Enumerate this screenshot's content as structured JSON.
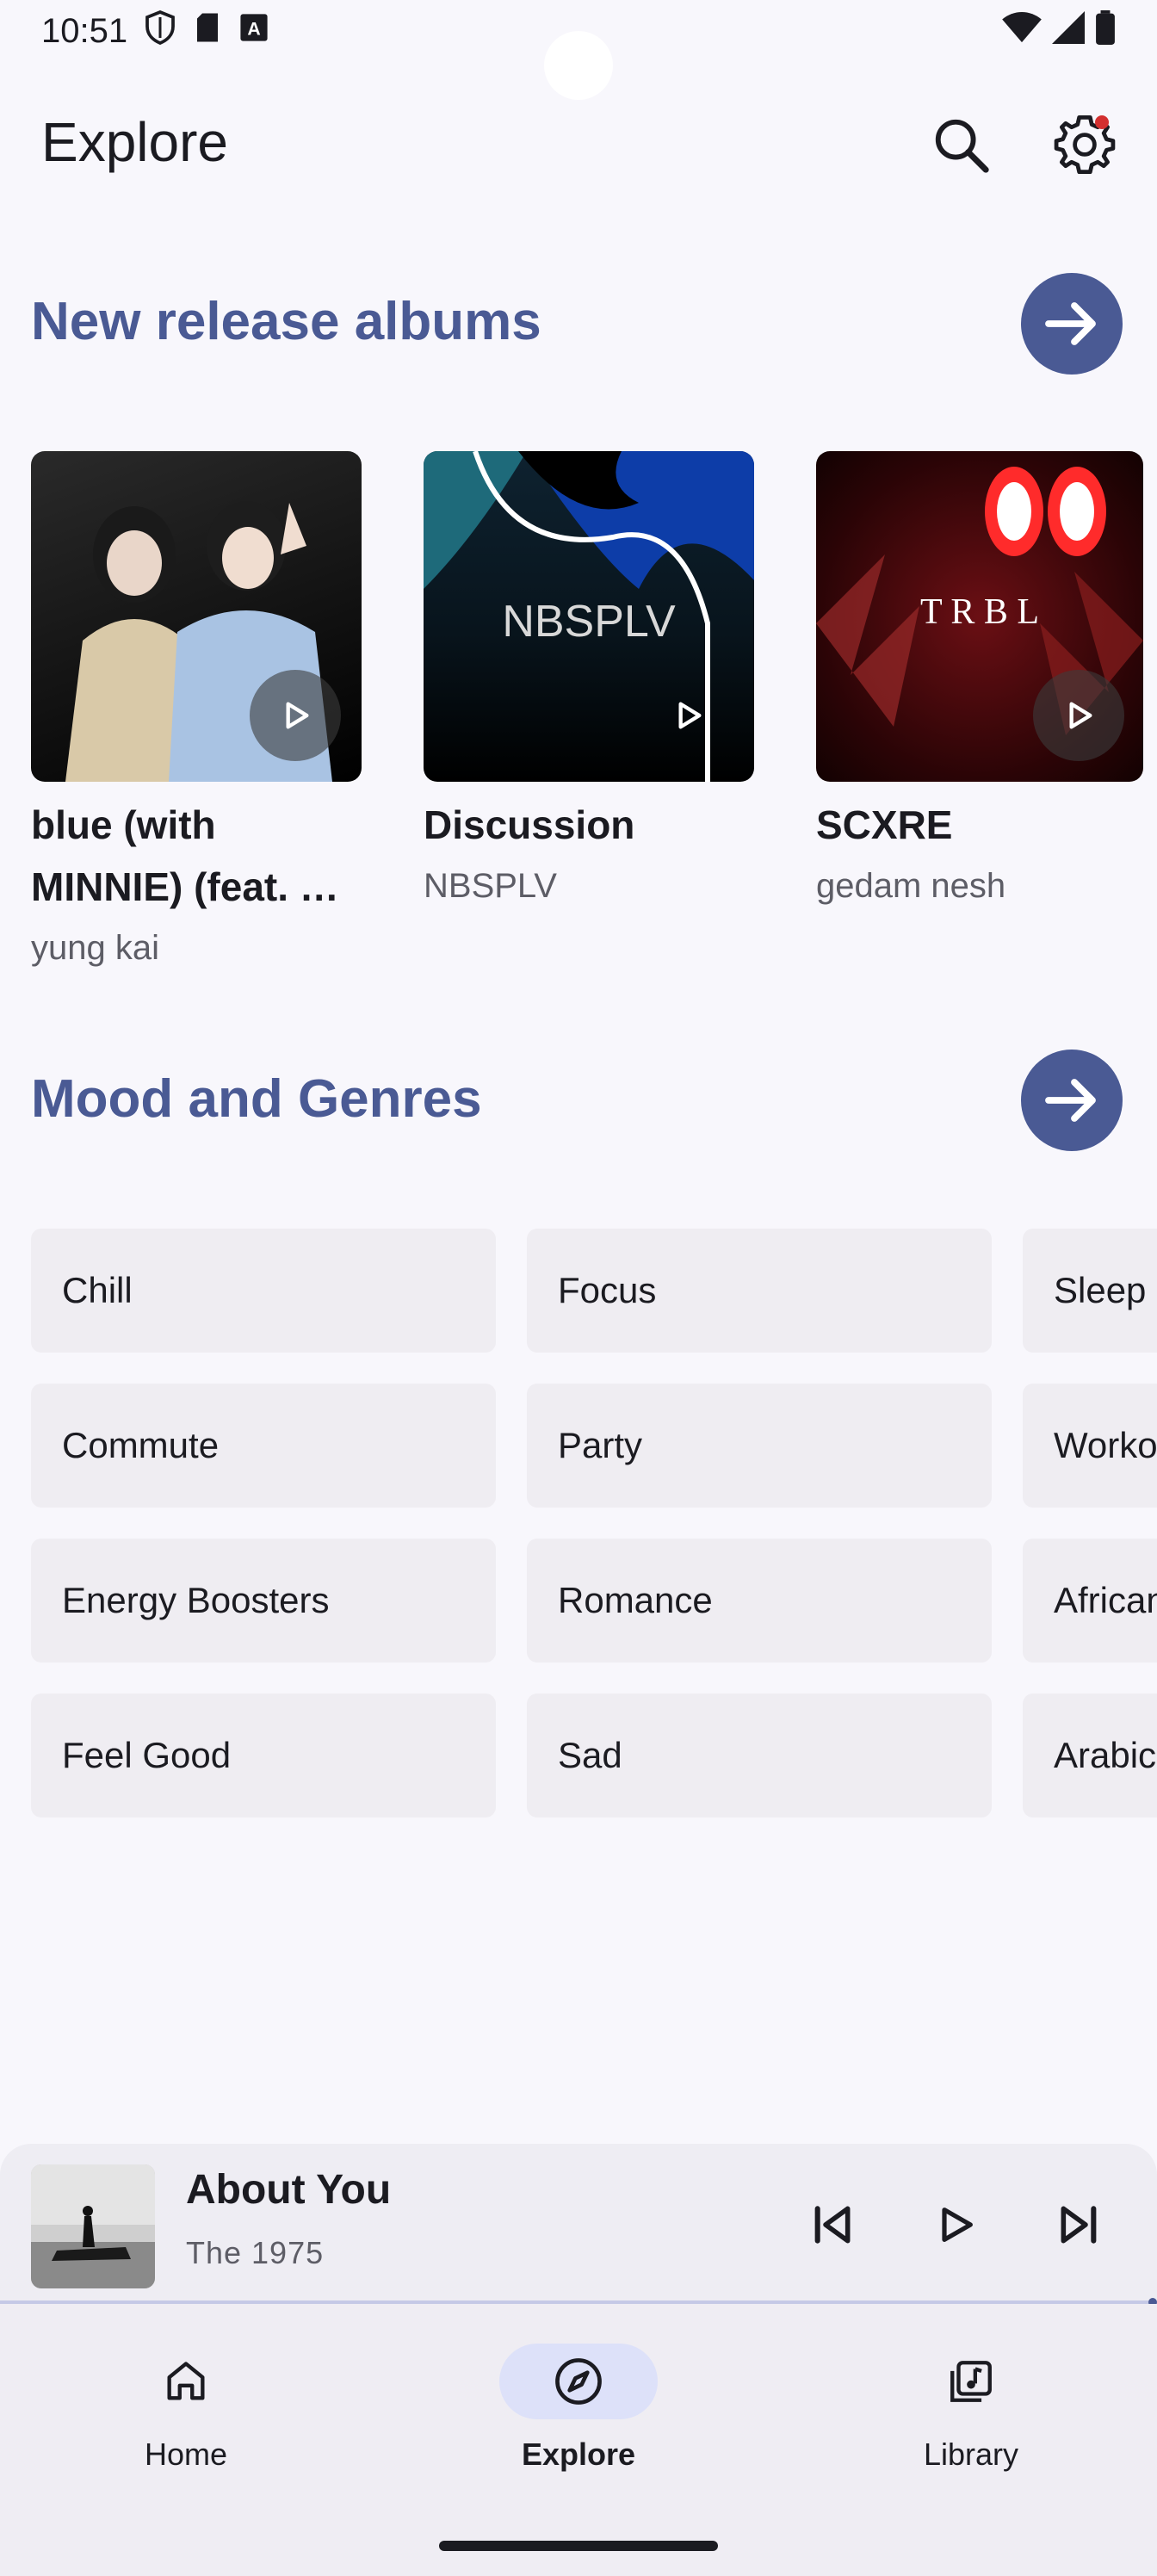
{
  "status": {
    "time": "10:51"
  },
  "header": {
    "title": "Explore"
  },
  "new_releases": {
    "title": "New release albums",
    "albums": [
      {
        "title_line1": "blue (with",
        "title_line2": "MINNIE) (feat. …",
        "artist": "yung kai"
      },
      {
        "title_line1": "Discussion",
        "title_line2": "",
        "artist": "NBSPLV",
        "art_text": "NBSPLV"
      },
      {
        "title_line1": "SCXRE",
        "title_line2": "",
        "artist": "gedam nesh",
        "art_text": "T R B L"
      }
    ]
  },
  "moods": {
    "title": "Mood and Genres",
    "rows": [
      [
        "Chill",
        "Focus",
        "Sleep"
      ],
      [
        "Commute",
        "Party",
        "Worko"
      ],
      [
        "Energy Boosters",
        "Romance",
        "African"
      ],
      [
        "Feel Good",
        "Sad",
        "Arabic"
      ]
    ]
  },
  "player": {
    "title": "About You",
    "artist": "The 1975",
    "progress": 0.0
  },
  "nav": {
    "home": "Home",
    "explore": "Explore",
    "library": "Library"
  },
  "colors": {
    "accent": "#4a5a94",
    "background": "#f8f7fc",
    "chip": "#efedf2"
  }
}
